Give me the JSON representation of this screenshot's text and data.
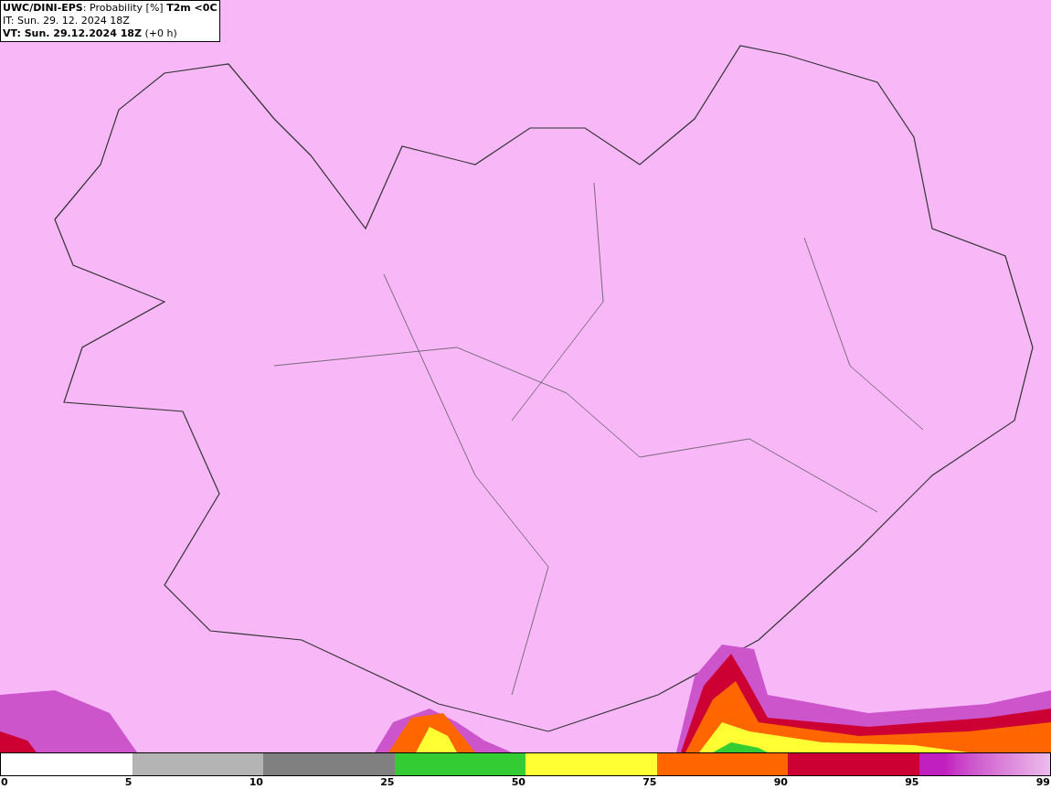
{
  "header": {
    "lines": [
      "**UWC/DINI-EPS**: Probability [%] **T2m <0C**",
      "IT: Sun. 29. 12. 2024 18Z",
      "**VT: Sun. 29.12.2024 18Z** (+0 h)"
    ]
  },
  "legend": {
    "bins": [
      {
        "color": "#ffffff"
      },
      {
        "color": "#b4b4b4"
      },
      {
        "color": "#808080"
      },
      {
        "color": "#33cc33"
      },
      {
        "color": "#ffff33"
      },
      {
        "color": "#ff6600"
      },
      {
        "color": "#cc0033"
      },
      {
        "color": "#c020c0",
        "kind": "gradient"
      }
    ],
    "labels": [
      "0",
      "5",
      "10",
      "25",
      "50",
      "75",
      "90",
      "95",
      "99"
    ]
  }
}
